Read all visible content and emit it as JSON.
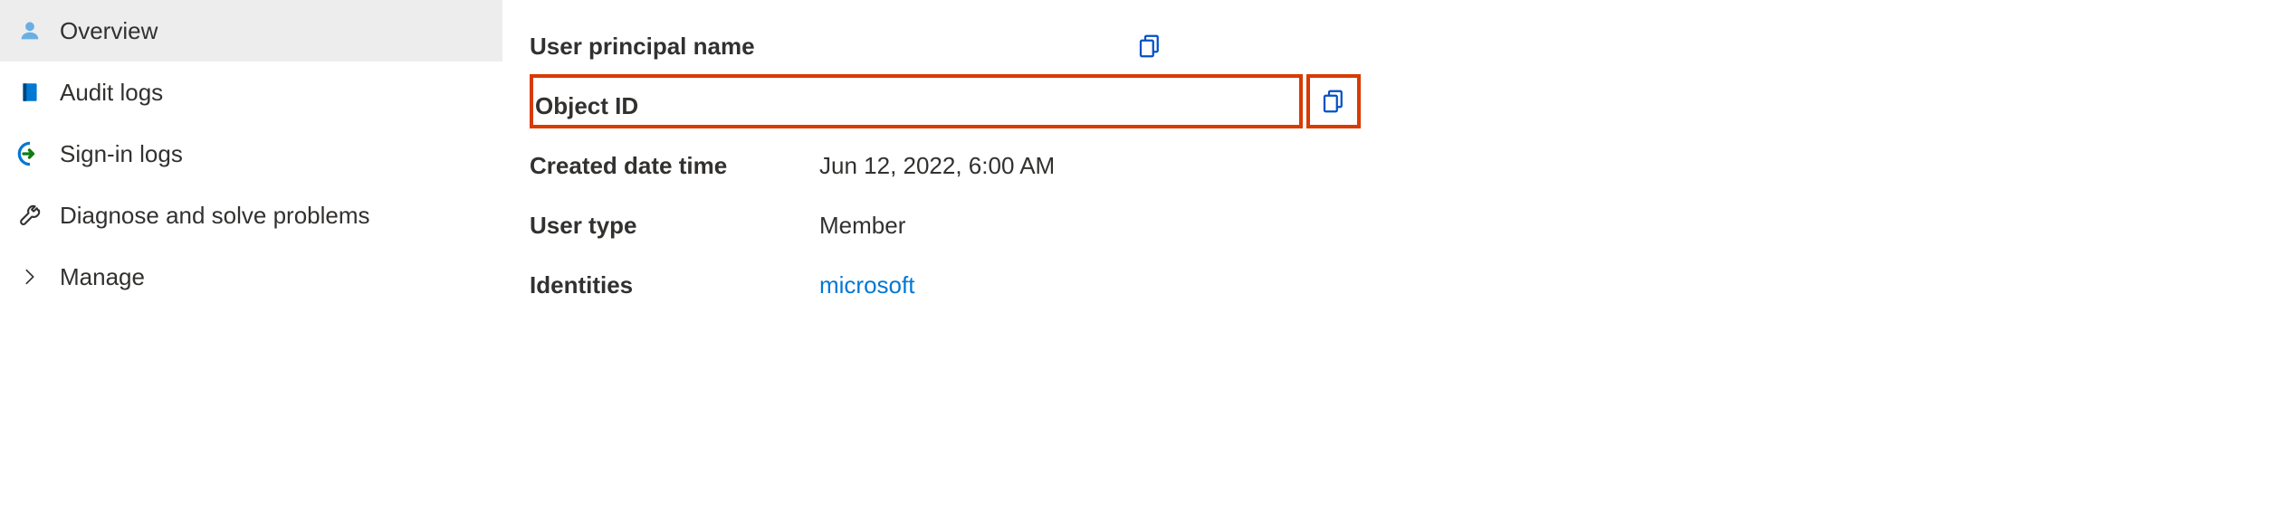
{
  "sidebar": {
    "items": {
      "overview": {
        "label": "Overview"
      },
      "audit_logs": {
        "label": "Audit logs"
      },
      "signin_logs": {
        "label": "Sign-in logs"
      },
      "diagnose": {
        "label": "Diagnose and solve problems"
      },
      "manage": {
        "label": "Manage"
      }
    }
  },
  "properties": {
    "upn": {
      "label": "User principal name",
      "value": ""
    },
    "object_id": {
      "label": "Object ID",
      "value": ""
    },
    "created": {
      "label": "Created date time",
      "value": "Jun 12, 2022, 6:00 AM"
    },
    "user_type": {
      "label": "User type",
      "value": "Member"
    },
    "identities": {
      "label": "Identities",
      "value": "microsoft"
    }
  },
  "colors": {
    "highlight": "#d83b01",
    "link": "#0078d4",
    "icon_blue": "#0078d4",
    "icon_green": "#107c10"
  }
}
